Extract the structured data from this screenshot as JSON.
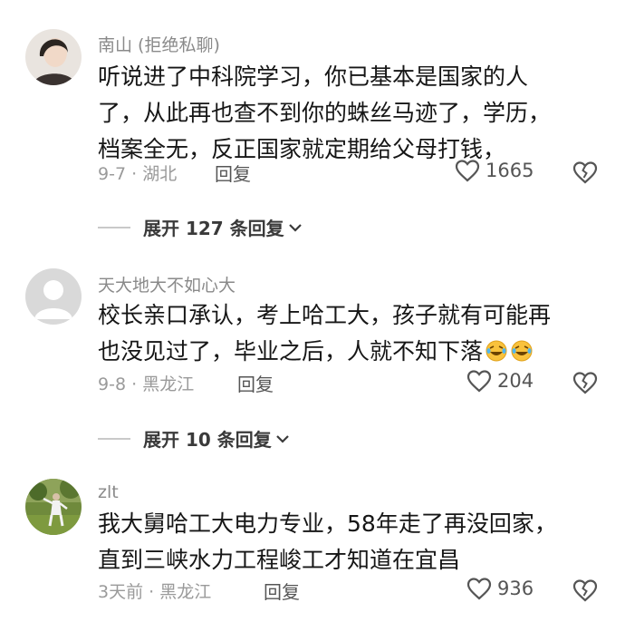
{
  "comments": [
    {
      "username": "南山 (拒绝私聊)",
      "lines": [
        "听说进了中科院学习，你已基本是国家的人",
        "了，从此再也查不到你的蛛丝马迹了，学历，",
        "档案全无，反正国家就定期给父母打钱，"
      ],
      "date": "9-7",
      "location": "湖北",
      "reply_label": "回复",
      "likes": "1665",
      "expand_label": "展开 127 条回复"
    },
    {
      "username": "天大地大不如心大",
      "lines": [
        "校长亲口承认，考上哈工大，孩子就有可能再",
        "也没见过了，毕业之后，人就不知下落"
      ],
      "date": "9-8",
      "location": "黑龙江",
      "reply_label": "回复",
      "likes": "204",
      "expand_label": "展开 10 条回复"
    },
    {
      "username": "zlt",
      "lines": [
        "我大舅哈工大电力专业，58年走了再没回家，",
        "直到三峡水力工程峻工才知道在宜昌"
      ],
      "date": "3天前",
      "location": "黑龙江",
      "reply_label": "回复",
      "likes": "936"
    }
  ],
  "separator": "·",
  "icons": {
    "like": "heart-outline-icon",
    "dislike": "broken-heart-icon",
    "expand": "chevron-down-icon",
    "emoji": "rofl-emoji-icon"
  },
  "colors": {
    "body_text": "#161616",
    "secondary_text": "#9a9a9a",
    "background": "#ffffff"
  }
}
